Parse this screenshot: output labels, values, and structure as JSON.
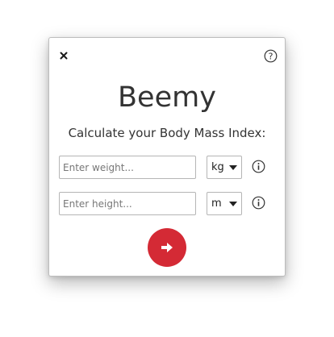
{
  "app": {
    "title": "Beemy",
    "subtitle": "Calculate your Body Mass Index:"
  },
  "weight": {
    "placeholder": "Enter weight...",
    "value": "",
    "unit": "kg"
  },
  "height": {
    "placeholder": "Enter height...",
    "value": "",
    "unit": "m"
  },
  "icons": {
    "close": "close-icon",
    "help": "help-icon",
    "info": "info-icon",
    "dropdown": "chevron-down-icon",
    "submit": "arrow-right-icon"
  },
  "colors": {
    "accent": "#d42a35",
    "text": "#333333"
  }
}
